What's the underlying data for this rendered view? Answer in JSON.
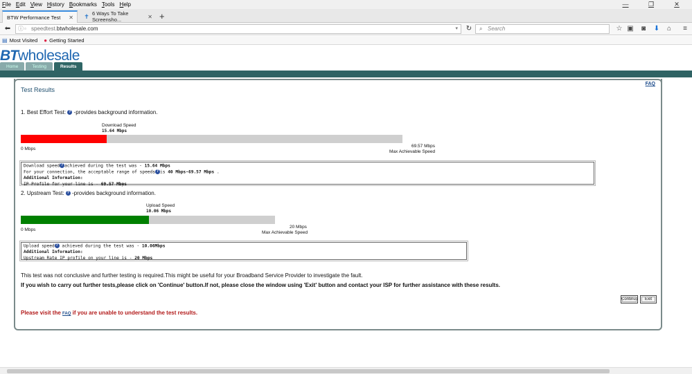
{
  "browser": {
    "menu": [
      "File",
      "Edit",
      "View",
      "History",
      "Bookmarks",
      "Tools",
      "Help"
    ],
    "window_controls": [
      "—",
      "❐",
      "✕"
    ],
    "tabs": [
      {
        "label": "BTW Performance Test",
        "active": true
      },
      {
        "label": "6 Ways To Take Screensho...",
        "active": false
      }
    ],
    "new_tab": "+",
    "url_prefix": "speedtest.",
    "url_domain": "btwholesale.com",
    "search_placeholder": "Search",
    "bookmarks": [
      "Most Visited",
      "Getting Started"
    ]
  },
  "site": {
    "logo_bt": "BT",
    "logo_rest": "wholesale",
    "nav_tabs": [
      "Home",
      "Testing",
      "Results"
    ],
    "active_tab": "Results"
  },
  "results": {
    "title": "Test Results",
    "faq": "FAQ",
    "best_effort": {
      "label_prefix": "1. Best Effort Test:",
      "label_suffix": "-provides background information.",
      "speed_title": "Download Speed",
      "speed_value": "15.64 Mbps",
      "measured": 15.64,
      "max": 69.57,
      "min_label": "0 Mbps",
      "max_label": "69.57 Mbps",
      "max_caption": "Max Achievable Speed",
      "bar_color": "#ff0000",
      "info": {
        "line1_a": "Download speed",
        "line1_b": "achieved during the test was - ",
        "line1_val": "15.64 Mbps",
        "line2_a": "For your connection, the acceptable range of speeds",
        "line2_b": "is ",
        "line2_val": "40 Mbps-69.57 Mbps",
        "line2_end": " .",
        "line3": "Additional Information:",
        "line4_a": "IP Profile for your line is - ",
        "line4_val": "69.57 Mbps"
      }
    },
    "upstream": {
      "label_prefix": "2. Upstream Test:",
      "label_suffix": "-provides background information.",
      "speed_title": "Upload Speed",
      "speed_value": "10.06 Mbps",
      "measured": 10.06,
      "max": 20,
      "min_label": "0 Mbps",
      "max_label": "20 Mbps",
      "max_caption": "Max Achievable Speed",
      "bar_color": "#008000",
      "info": {
        "line1_a": "Upload speed",
        "line1_b": " achieved during the test was - ",
        "line1_val": "10.06Mbps",
        "line2": "Additional Information:",
        "line3_a": "Upstream Rate IP profile on your line is - ",
        "line3_val": "20 Mbps"
      }
    },
    "message1": "This test was not conclusive and further testing is required.This might be useful for your Broadband Service Provider to investigate the fault.",
    "message2": "If you wish to carry out further tests,please click on 'Continue' button.If not, please close the window using 'Exit' button and contact your ISP for further assistance with these results.",
    "continue_label": "Continue",
    "exit_label": "Exit",
    "faq_msg_a": "Please visit the ",
    "faq_msg_link": "FAQ",
    "faq_msg_b": " if you are unable to understand the test results."
  }
}
